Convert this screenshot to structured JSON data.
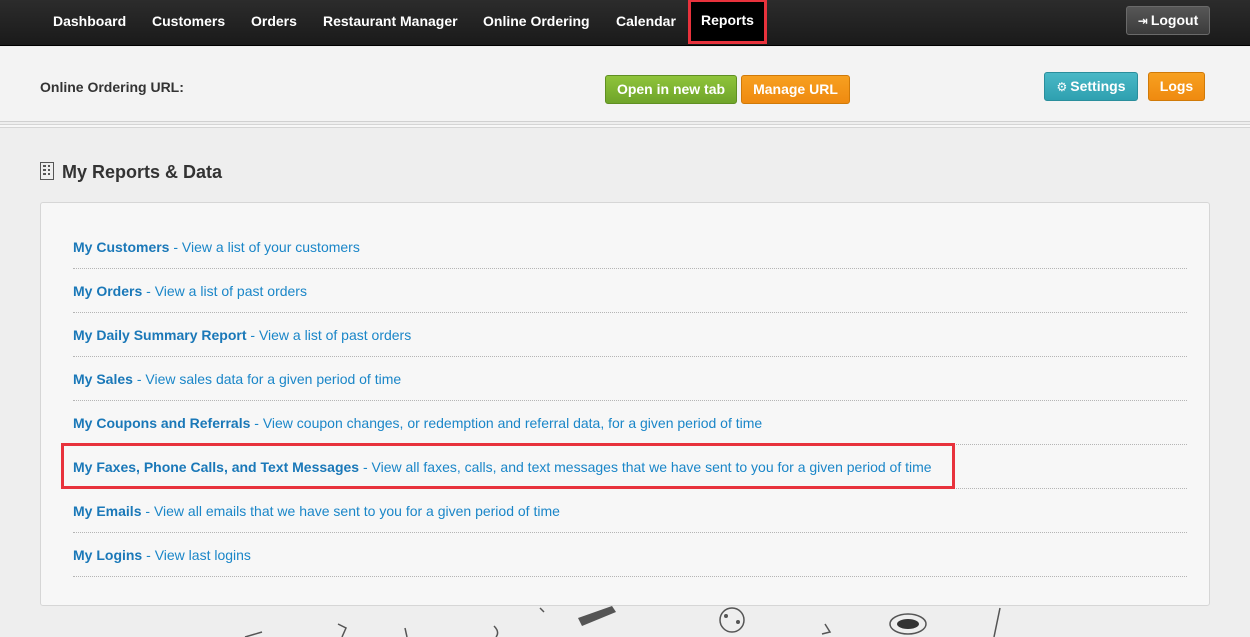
{
  "nav": {
    "items": [
      {
        "label": "Dashboard"
      },
      {
        "label": "Customers"
      },
      {
        "label": "Orders"
      },
      {
        "label": "Restaurant Manager"
      },
      {
        "label": "Online Ordering"
      },
      {
        "label": "Calendar"
      },
      {
        "label": "Reports",
        "active": true
      }
    ],
    "logout_label": "Logout"
  },
  "urlbar": {
    "label": "Online Ordering URL:",
    "open_new_tab_label": "Open in new tab",
    "manage_url_label": "Manage URL",
    "settings_label": "Settings",
    "logs_label": "Logs"
  },
  "section": {
    "title": "My Reports & Data",
    "icon": "building-icon"
  },
  "reports": [
    {
      "title": "My Customers",
      "desc": "View a list of your customers"
    },
    {
      "title": "My Orders",
      "desc": "View a list of past orders"
    },
    {
      "title": "My Daily Summary Report",
      "desc": "View a list of past orders"
    },
    {
      "title": "My Sales",
      "desc": "View sales data for a given period of time"
    },
    {
      "title": "My Coupons and Referrals",
      "desc": "View coupon changes, or redemption and referral data, for a given period of time"
    },
    {
      "title": "My Faxes, Phone Calls, and Text Messages",
      "desc": "View all faxes, calls, and text messages that we have sent to you for a given period of time",
      "highlighted": true
    },
    {
      "title": "My Emails",
      "desc": "View all emails that we have sent to you for a given period of time"
    },
    {
      "title": "My Logins",
      "desc": "View last logins"
    }
  ],
  "colors": {
    "nav_bg": "#1f1f1f",
    "highlight": "#e8323c",
    "link": "#1a78b8",
    "green_btn": "#7db332",
    "orange_btn": "#f29418",
    "teal_btn": "#38a9b8"
  }
}
